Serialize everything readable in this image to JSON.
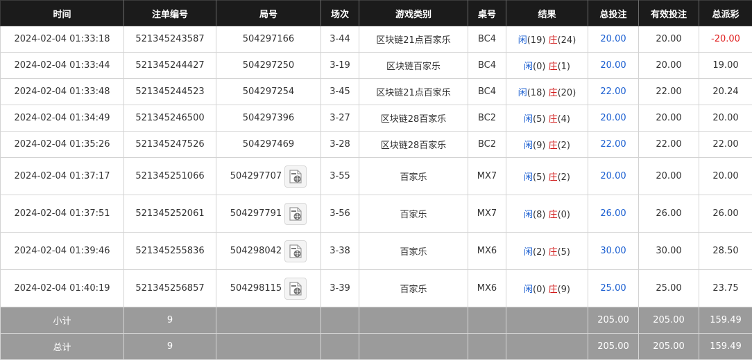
{
  "headers": [
    "时间",
    "注单编号",
    "局号",
    "场次",
    "游戏类别",
    "桌号",
    "结果",
    "总投注",
    "有效投注",
    "总派彩"
  ],
  "result_labels": {
    "player": "闲",
    "banker": "庄"
  },
  "rows": [
    {
      "time": "2024-02-04 01:33:18",
      "bet_id": "521345243587",
      "round": "504297166",
      "shoe": "3-44",
      "game": "区块链21点百家乐",
      "table": "BC4",
      "player_score": "(19)",
      "banker_score": "(24)",
      "total_bet": "20.00",
      "valid_bet": "20.00",
      "payout": "-20.00",
      "has_video": false
    },
    {
      "time": "2024-02-04 01:33:44",
      "bet_id": "521345244427",
      "round": "504297250",
      "shoe": "3-19",
      "game": "区块链百家乐",
      "table": "BC4",
      "player_score": "(0)",
      "banker_score": "(1)",
      "total_bet": "20.00",
      "valid_bet": "20.00",
      "payout": "19.00",
      "has_video": false
    },
    {
      "time": "2024-02-04 01:33:48",
      "bet_id": "521345244523",
      "round": "504297254",
      "shoe": "3-45",
      "game": "区块链21点百家乐",
      "table": "BC4",
      "player_score": "(18)",
      "banker_score": "(20)",
      "total_bet": "22.00",
      "valid_bet": "22.00",
      "payout": "20.24",
      "has_video": false
    },
    {
      "time": "2024-02-04 01:34:49",
      "bet_id": "521345246500",
      "round": "504297396",
      "shoe": "3-27",
      "game": "区块链28百家乐",
      "table": "BC2",
      "player_score": "(5)",
      "banker_score": "(4)",
      "total_bet": "20.00",
      "valid_bet": "20.00",
      "payout": "20.00",
      "has_video": false
    },
    {
      "time": "2024-02-04 01:35:26",
      "bet_id": "521345247526",
      "round": "504297469",
      "shoe": "3-28",
      "game": "区块链28百家乐",
      "table": "BC2",
      "player_score": "(9)",
      "banker_score": "(2)",
      "total_bet": "22.00",
      "valid_bet": "22.00",
      "payout": "22.00",
      "has_video": false
    },
    {
      "time": "2024-02-04 01:37:17",
      "bet_id": "521345251066",
      "round": "504297707",
      "shoe": "3-55",
      "game": "百家乐",
      "table": "MX7",
      "player_score": "(5)",
      "banker_score": "(2)",
      "total_bet": "20.00",
      "valid_bet": "20.00",
      "payout": "20.00",
      "has_video": true
    },
    {
      "time": "2024-02-04 01:37:51",
      "bet_id": "521345252061",
      "round": "504297791",
      "shoe": "3-56",
      "game": "百家乐",
      "table": "MX7",
      "player_score": "(8)",
      "banker_score": "(0)",
      "total_bet": "26.00",
      "valid_bet": "26.00",
      "payout": "26.00",
      "has_video": true
    },
    {
      "time": "2024-02-04 01:39:46",
      "bet_id": "521345255836",
      "round": "504298042",
      "shoe": "3-38",
      "game": "百家乐",
      "table": "MX6",
      "player_score": "(2)",
      "banker_score": "(5)",
      "total_bet": "30.00",
      "valid_bet": "30.00",
      "payout": "28.50",
      "has_video": true
    },
    {
      "time": "2024-02-04 01:40:19",
      "bet_id": "521345256857",
      "round": "504298115",
      "shoe": "3-39",
      "game": "百家乐",
      "table": "MX6",
      "player_score": "(0)",
      "banker_score": "(9)",
      "total_bet": "25.00",
      "valid_bet": "25.00",
      "payout": "23.75",
      "has_video": true
    }
  ],
  "subtotal": {
    "label": "小计",
    "count": "9",
    "total_bet": "205.00",
    "valid_bet": "205.00",
    "payout": "159.49"
  },
  "total": {
    "label": "总计",
    "count": "9",
    "total_bet": "205.00",
    "valid_bet": "205.00",
    "payout": "159.49"
  },
  "colors": {
    "player": "#1b5fd1",
    "banker": "#d11a1a",
    "negative": "#e02020",
    "header_bg": "#1b1b1b",
    "footer_bg": "#9b9b9b"
  },
  "icons": {
    "video": "video-replay-icon"
  }
}
